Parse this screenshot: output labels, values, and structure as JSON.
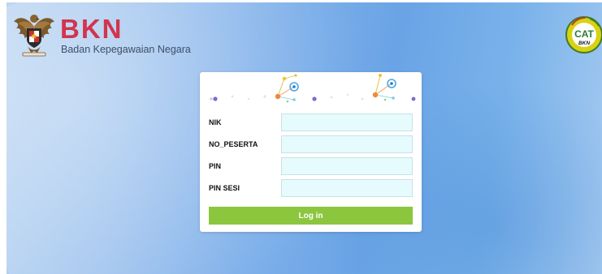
{
  "brand": {
    "name": "BKN",
    "subtitle": "Badan Kepegawaian Negara",
    "name_color": "#d2344e"
  },
  "cat_badge": {
    "label": "CAT",
    "sublabel": "BKN",
    "ring_color": "#d8d20f"
  },
  "form": {
    "fields": [
      {
        "label": "NIK",
        "value": "",
        "placeholder": ""
      },
      {
        "label": "NO_PESERTA",
        "value": "",
        "placeholder": ""
      },
      {
        "label": "PIN",
        "value": "",
        "placeholder": ""
      },
      {
        "label": "PIN SESI",
        "value": "",
        "placeholder": ""
      }
    ],
    "submit_label": "Log in",
    "input_bg": "#e5fbfd",
    "button_color": "#8cc63f"
  }
}
